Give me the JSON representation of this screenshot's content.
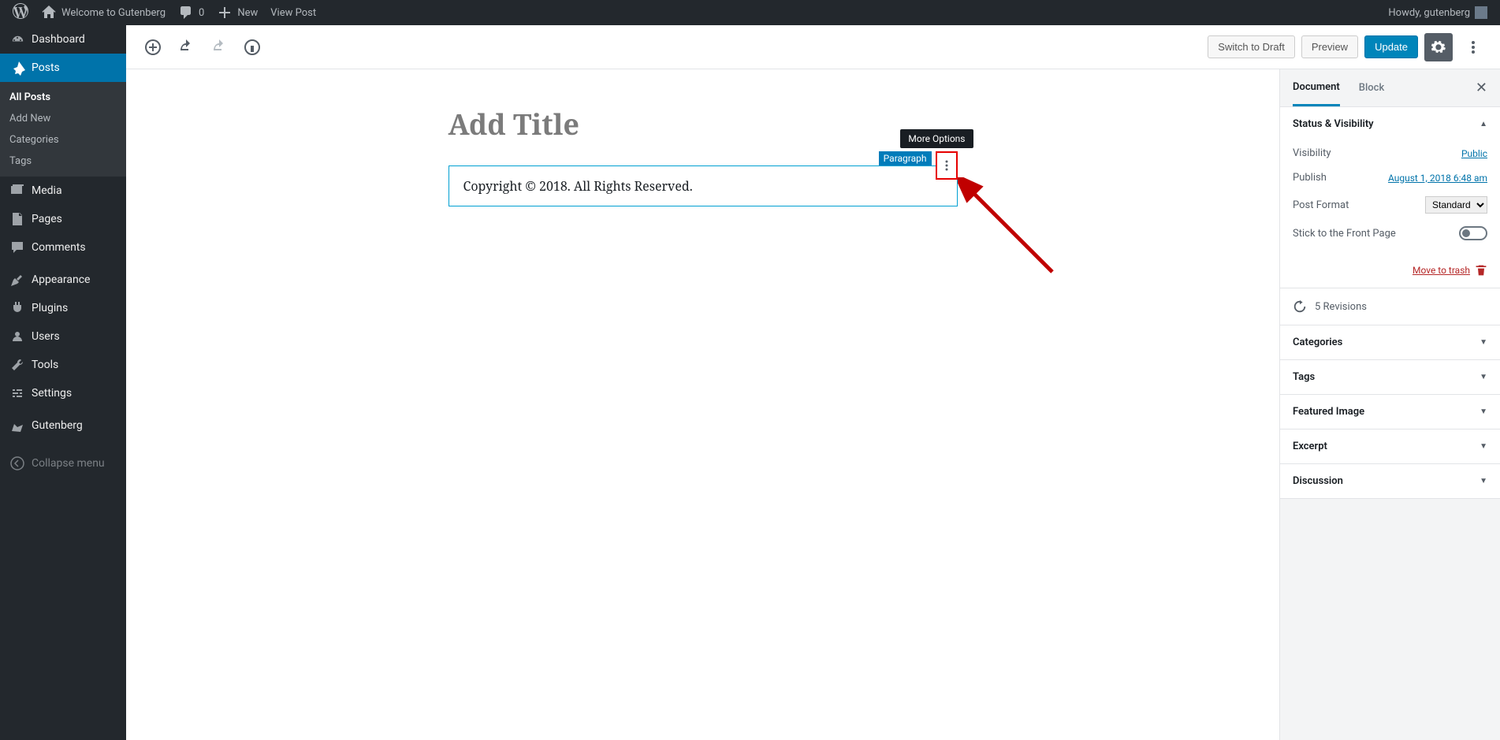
{
  "adminbar": {
    "site_title": "Welcome to Gutenberg",
    "comments_count": "0",
    "new_label": "New",
    "view_post": "View Post",
    "howdy": "Howdy, gutenberg"
  },
  "adminmenu": {
    "dashboard": "Dashboard",
    "posts": "Posts",
    "posts_sub": [
      {
        "label": "All Posts",
        "current": true
      },
      {
        "label": "Add New"
      },
      {
        "label": "Categories"
      },
      {
        "label": "Tags"
      }
    ],
    "media": "Media",
    "pages": "Pages",
    "comments": "Comments",
    "appearance": "Appearance",
    "plugins": "Plugins",
    "users": "Users",
    "tools": "Tools",
    "settings": "Settings",
    "gutenberg": "Gutenberg",
    "collapse": "Collapse menu"
  },
  "editor": {
    "switch_draft": "Switch to Draft",
    "preview": "Preview",
    "update": "Update",
    "title_placeholder": "Add Title",
    "paragraph_text": "Copyright © 2018. All Rights Reserved.",
    "block_label": "Paragraph",
    "tooltip": "More Options"
  },
  "inspector": {
    "tab_document": "Document",
    "tab_block": "Block",
    "status_panel": {
      "title": "Status & Visibility",
      "visibility_label": "Visibility",
      "visibility_value": "Public",
      "publish_label": "Publish",
      "publish_value": "August 1, 2018 6:48 am",
      "format_label": "Post Format",
      "format_value": "Standard",
      "stick_label": "Stick to the Front Page",
      "trash": "Move to trash"
    },
    "revisions": "5 Revisions",
    "panels": [
      "Categories",
      "Tags",
      "Featured Image",
      "Excerpt",
      "Discussion"
    ]
  }
}
